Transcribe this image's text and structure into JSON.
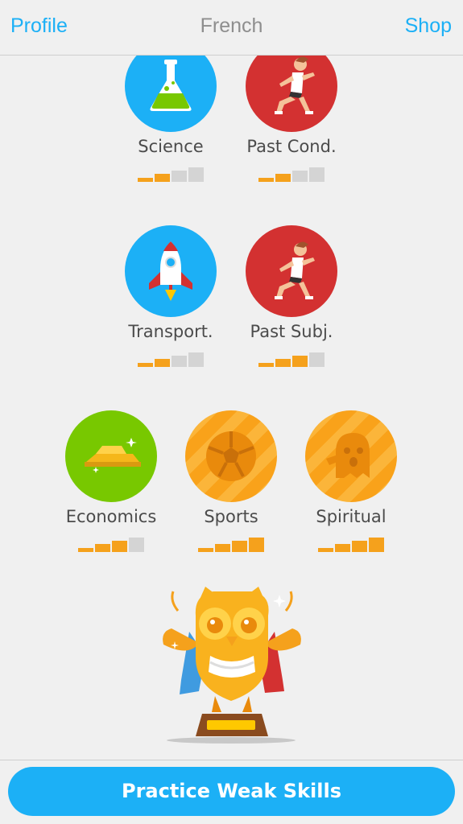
{
  "header": {
    "left_label": "Profile",
    "title": "French",
    "right_label": "Shop"
  },
  "skills": [
    {
      "label": "Science",
      "icon": "flask-icon",
      "color": "#1cb0f6",
      "strength": 2,
      "max_strength": 4
    },
    {
      "label": "Past Cond.",
      "icon": "runner-icon",
      "color": "#d33131",
      "strength": 2,
      "max_strength": 4
    },
    {
      "label": "Transport.",
      "icon": "rocket-icon",
      "color": "#1cb0f6",
      "strength": 2,
      "max_strength": 4
    },
    {
      "label": "Past Subj.",
      "icon": "runner-icon",
      "color": "#d33131",
      "strength": 3,
      "max_strength": 4
    },
    {
      "label": "Economics",
      "icon": "gold-bars-icon",
      "color": "#78c800",
      "strength": 3,
      "max_strength": 4
    },
    {
      "label": "Sports",
      "icon": "soccer-ball-icon",
      "color": "#f9a21a",
      "strength": 4,
      "max_strength": 4
    },
    {
      "label": "Spiritual",
      "icon": "ghost-icon",
      "color": "#f9a21a",
      "strength": 4,
      "max_strength": 4
    }
  ],
  "trophy_icon": "owl-trophy-icon",
  "practice_button": {
    "label": "Practice Weak Skills"
  },
  "colors": {
    "accent": "#1cb0f6",
    "strength_on": "#f5a11c",
    "strength_off": "#d4d4d4"
  }
}
